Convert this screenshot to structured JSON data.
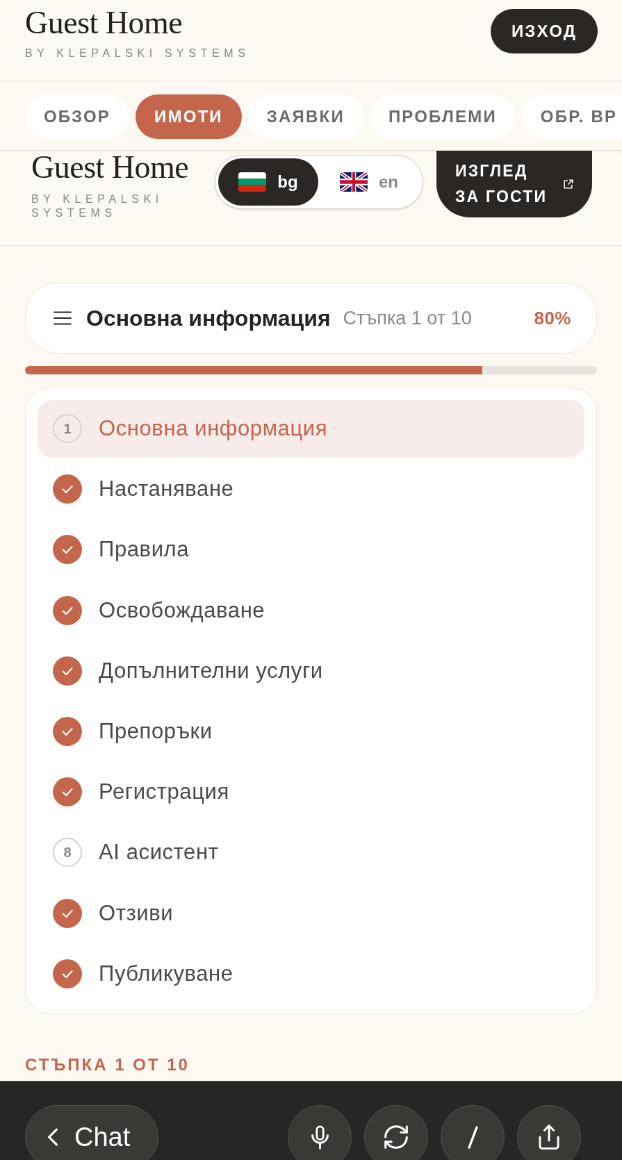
{
  "header": {
    "title": "Guest Home",
    "subtitle": "BY KLEPALSKI SYSTEMS",
    "exit_button": "ИЗХОД"
  },
  "tabs": [
    {
      "label": "ОБЗОР",
      "selected": false
    },
    {
      "label": "ИМОТИ",
      "selected": true
    },
    {
      "label": "ЗАЯВКИ",
      "selected": false
    },
    {
      "label": "ПРОБЛЕМИ",
      "selected": false
    },
    {
      "label": "ОБР. ВР",
      "selected": false
    }
  ],
  "sub_header": {
    "title": "Guest Home",
    "subtitle": "BY KLEPALSKI SYSTEMS",
    "languages": [
      {
        "kind": "bulgaria",
        "label": "bg",
        "selected": true
      },
      {
        "kind": "britain",
        "label": "en",
        "selected": false
      }
    ],
    "guest_view_button": "ИЗГЛЕД ЗА ГОСТИ"
  },
  "step_header": {
    "title": "Основна информация",
    "step": "Стъпка 1 от 10",
    "percent": "80%"
  },
  "progress": {
    "level": 0.8
  },
  "steps": [
    {
      "number": "1",
      "label": "Основна информация",
      "done": false,
      "selected": true
    },
    {
      "label": "Настаняване",
      "done": true,
      "selected": false
    },
    {
      "label": "Правила",
      "done": true,
      "selected": false
    },
    {
      "label": "Освобождаване",
      "done": true,
      "selected": false
    },
    {
      "label": "Допълнителни услуги",
      "done": true,
      "selected": false
    },
    {
      "label": "Препоръки",
      "done": true,
      "selected": false
    },
    {
      "label": "Регистрация",
      "done": true,
      "selected": false
    },
    {
      "number": "8",
      "label": "AI асистент",
      "done": false,
      "selected": false
    },
    {
      "label": "Отзиви",
      "done": true,
      "selected": false
    },
    {
      "label": "Публикуване",
      "done": true,
      "selected": false
    }
  ],
  "step_label": "СТЪПКА 1 ОТ 10",
  "bottom_bar": {
    "chat_button": "Chat"
  }
}
